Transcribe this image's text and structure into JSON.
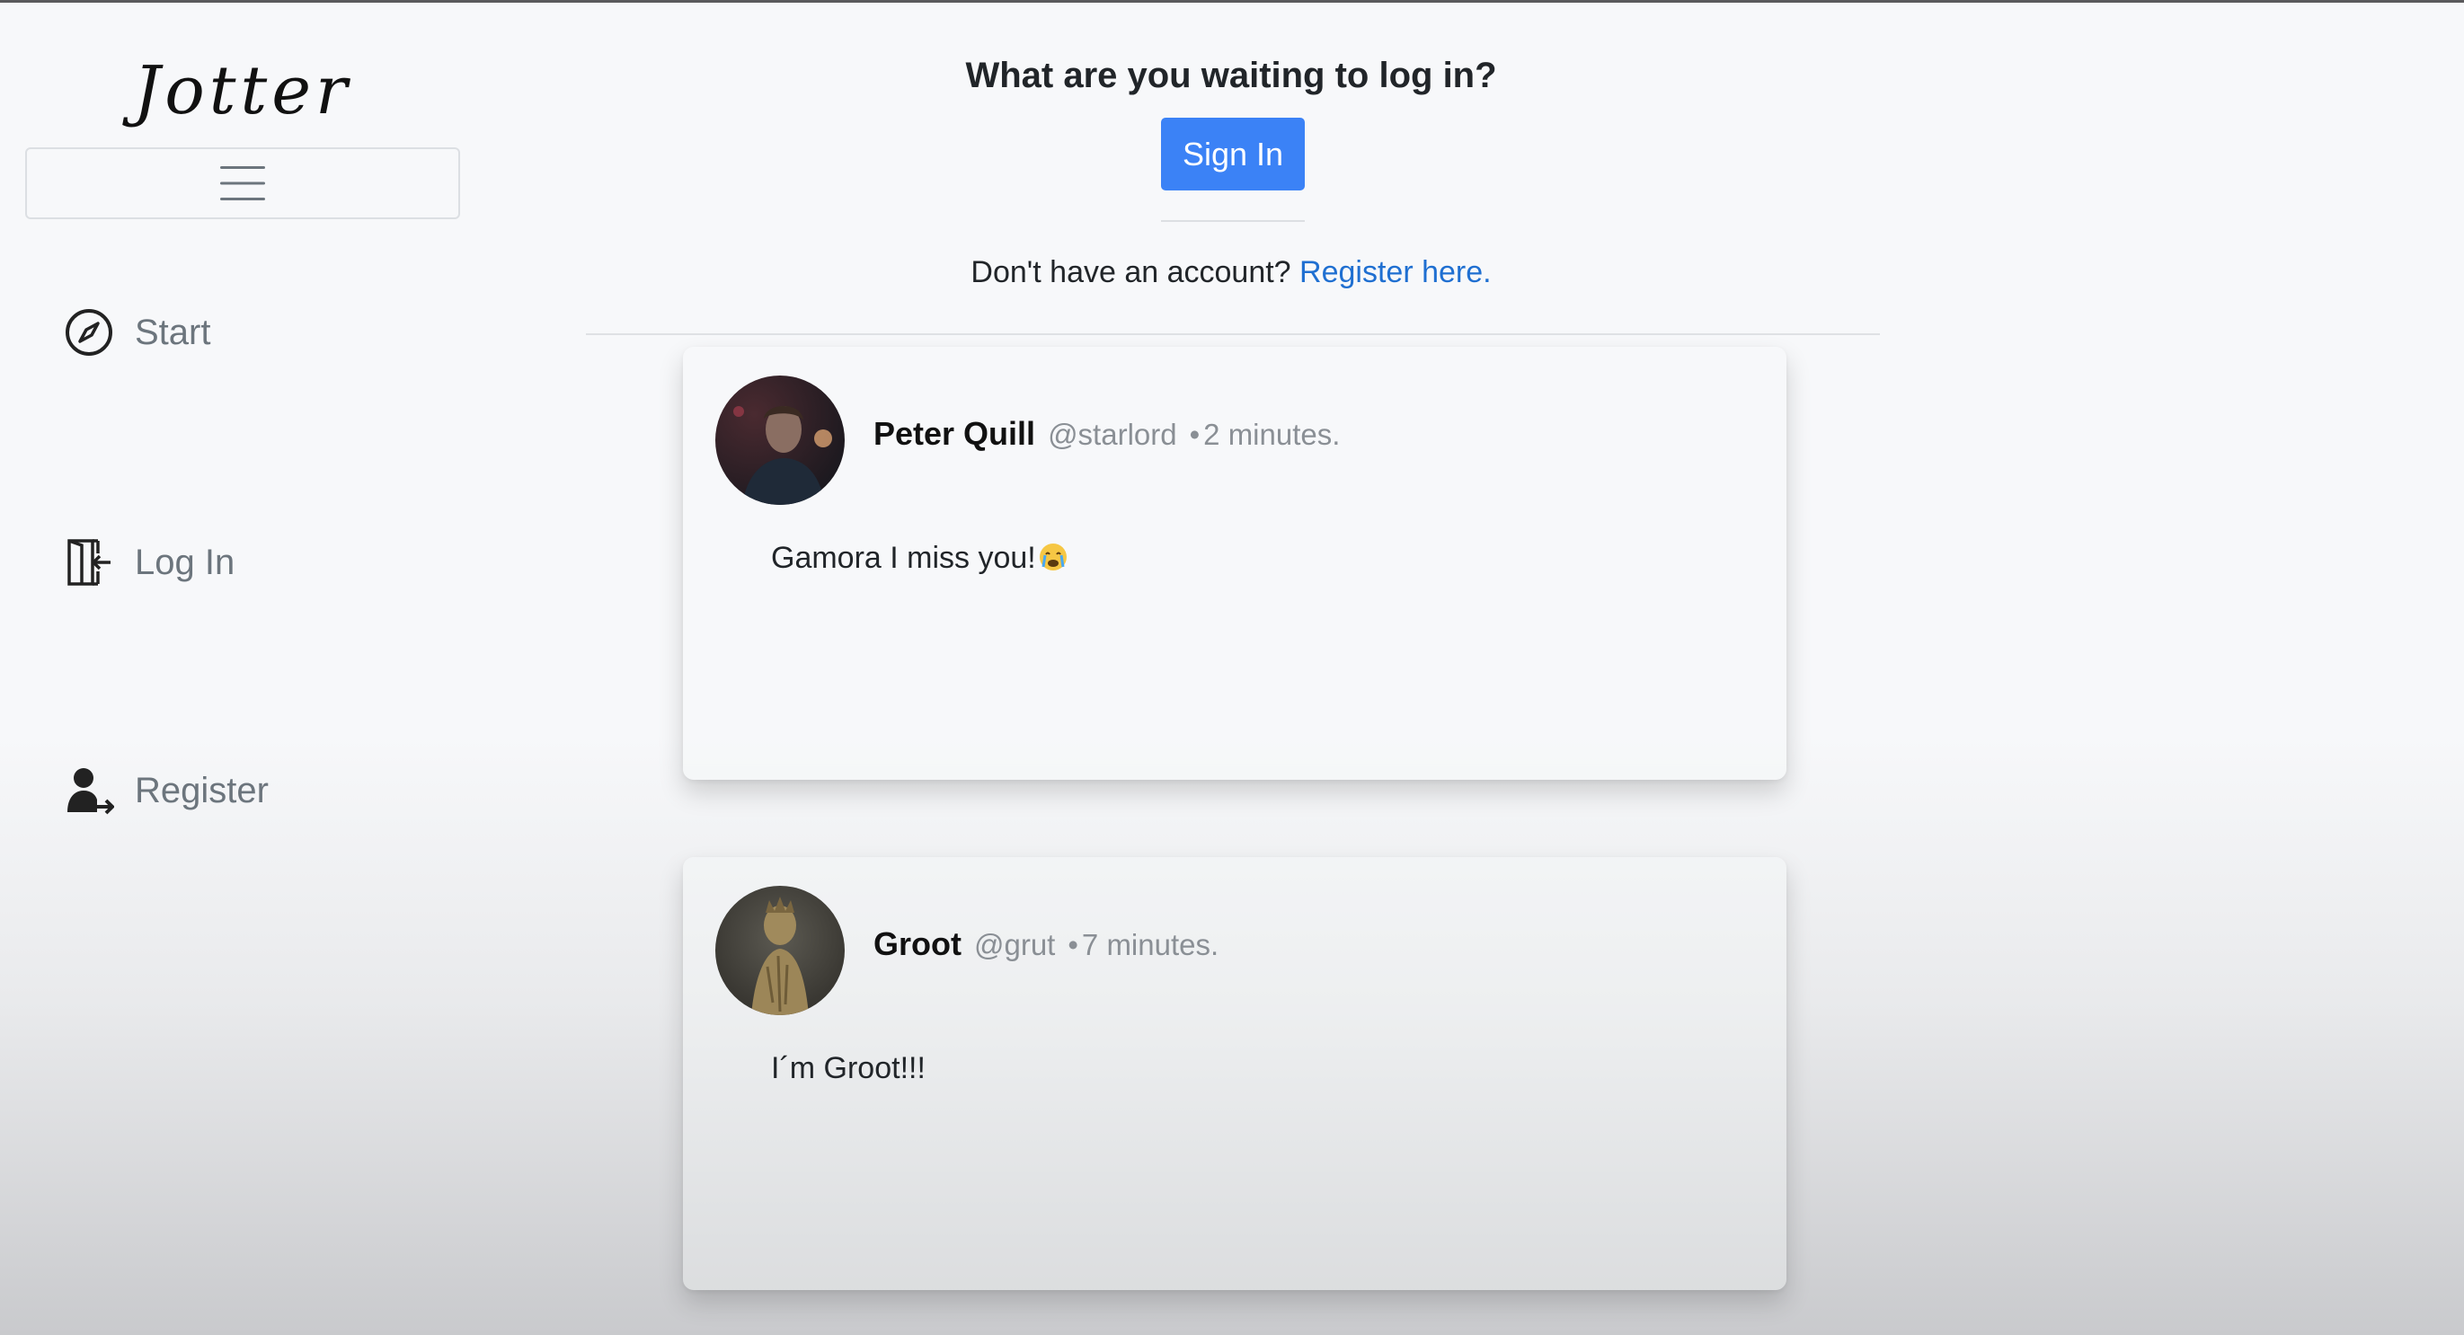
{
  "sidebar": {
    "logo": "Jotter",
    "nav": [
      {
        "label": "Start",
        "icon": "compass-icon"
      },
      {
        "label": "Log In",
        "icon": "door-enter-icon"
      },
      {
        "label": "Register",
        "icon": "person-add-icon"
      }
    ],
    "menu_icon": "hamburger-menu-icon"
  },
  "login_prompt": {
    "title": "What are you waiting to log in?",
    "sign_in_label": "Sign In",
    "no_account_text": "Don't have an account?",
    "register_link": "Register here."
  },
  "posts": [
    {
      "name": "Peter Quill",
      "handle": "@starlord",
      "dot": "•",
      "time": "2 minutes.",
      "text": "Gamora I miss you!",
      "emoji": "crying-face-emoji"
    },
    {
      "name": "Groot",
      "handle": "@grut",
      "dot": "•",
      "time": "7 minutes.",
      "text": "I´m Groot!!!"
    }
  ],
  "colors": {
    "primary": "#3b82f6",
    "link": "#1f6fd1",
    "muted": "#6c757d"
  }
}
